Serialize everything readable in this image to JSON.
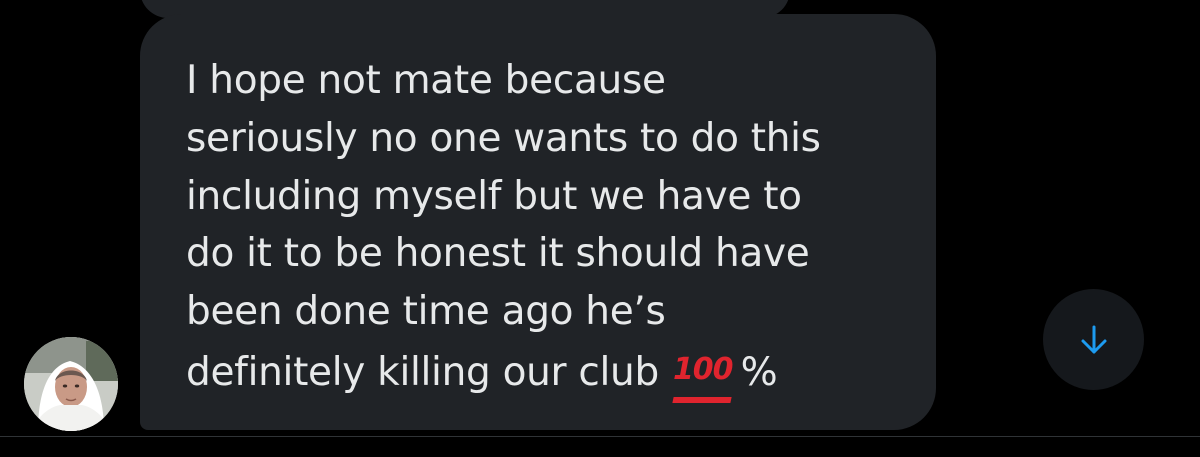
{
  "conversation": {
    "message": {
      "lines": [
        "I hope not mate because",
        "seriously no one wants to do this",
        "including myself but we have to",
        "do it to be honest it should have",
        "been done time ago he’s",
        "definitely killing our club"
      ],
      "emoji_icon": "hundred-points-emoji",
      "emoji_text": "100",
      "suffix": "%"
    },
    "sender_avatar_icon": "avatar",
    "scroll_down_icon": "arrow-down-icon"
  },
  "colors": {
    "background": "#000000",
    "bubble": "#202327",
    "text": "#e7e9ea",
    "accent": "#1d9bf0",
    "emoji_red": "#e0242e"
  }
}
